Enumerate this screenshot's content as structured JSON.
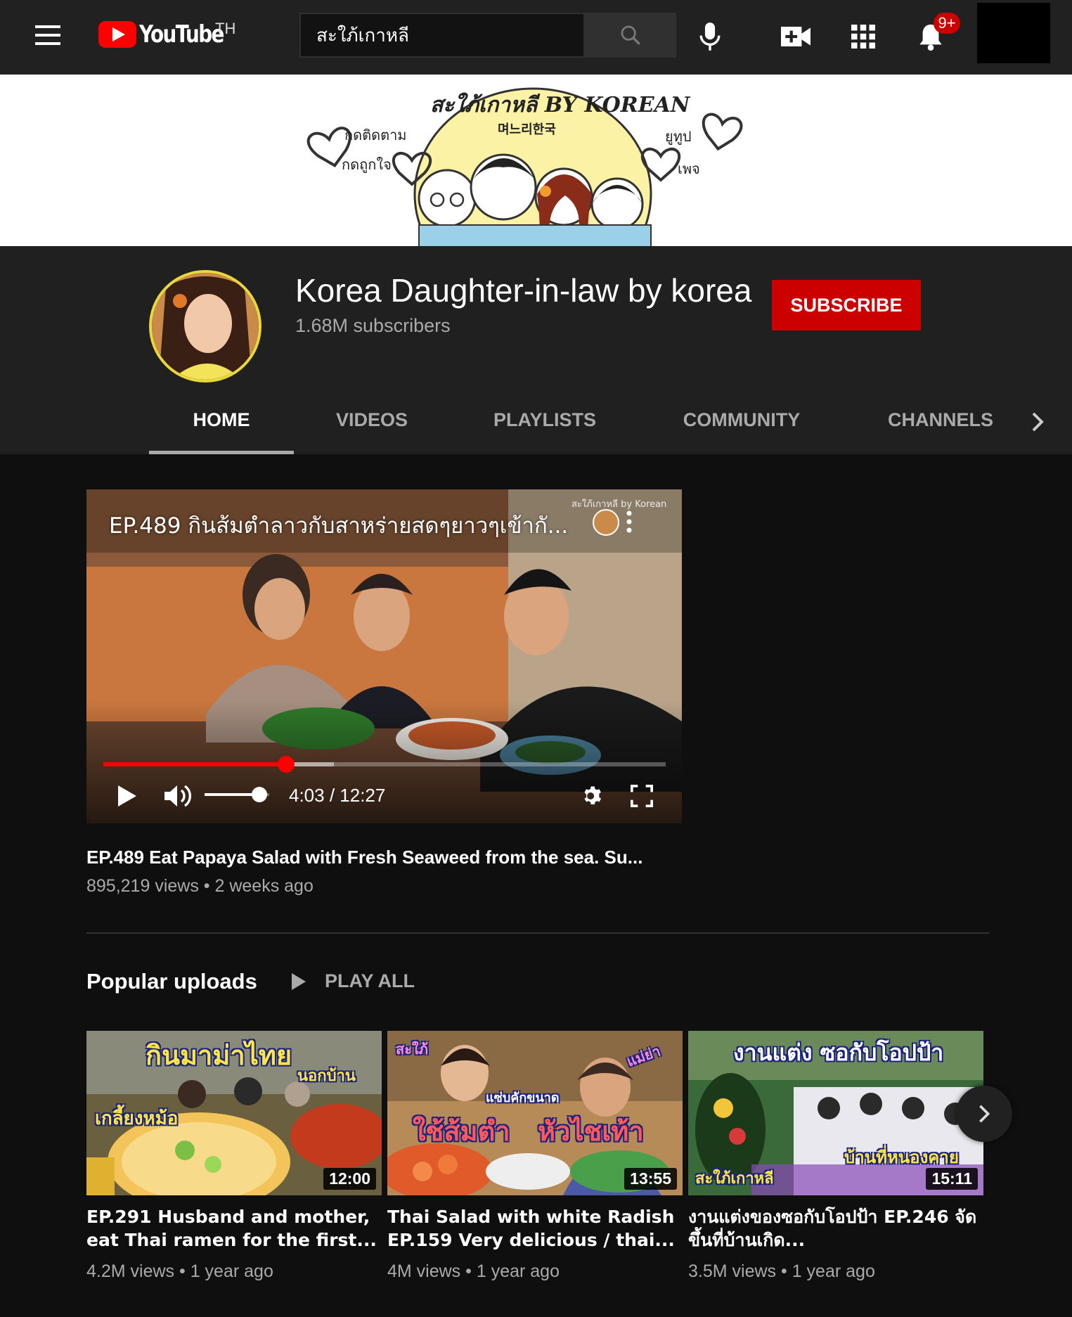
{
  "topbar": {
    "logo_text": "YouTube",
    "region": "TH",
    "search_value": "สะใภ้เกาหลี",
    "notification_count": "9+",
    "icons": [
      "menu-icon",
      "search-icon",
      "mic-icon",
      "create-video-icon",
      "apps-icon",
      "bell-icon"
    ]
  },
  "banner": {
    "title": "สะใภ้เกาหลี BY KOREAN",
    "korean": "며느리한국",
    "left_top": "กดติดตาม",
    "left_bottom": "กดถูกใจ",
    "right_top": "ยูทูป",
    "right_bottom": "เพจ"
  },
  "channel": {
    "name": "Korea Daughter-in-law by korea",
    "subscribers": "1.68M subscribers",
    "subscribe_label": "SUBSCRIBE",
    "tabs": [
      {
        "label": "HOME",
        "active": true
      },
      {
        "label": "VIDEOS",
        "active": false
      },
      {
        "label": "PLAYLISTS",
        "active": false
      },
      {
        "label": "COMMUNITY",
        "active": false
      },
      {
        "label": "CHANNELS",
        "active": false
      }
    ]
  },
  "featured": {
    "overlay_title": "EP.489 กินส้มตำลาวกับสาหร่ายสดๆยาวๆเข้ากั...",
    "watermark": "สะใภ้เกาหลี by Korean",
    "time": "4:03 / 12:27",
    "progress_fraction": 0.325,
    "buffered_fraction": 0.41,
    "volume_fraction": 0.85,
    "title": "EP.489 Eat Papaya Salad with Fresh Seaweed from the sea. Su...",
    "views": "895,219 views",
    "age": "2 weeks ago"
  },
  "popular": {
    "heading": "Popular uploads",
    "play_all": "PLAY ALL",
    "cards": [
      {
        "title": "EP.291 Husband and mother, eat Thai ramen for the first...",
        "views": "4.2M views",
        "age": "1 year ago",
        "duration": "12:00",
        "thumb_text_1": "กินมาม่าไทย",
        "thumb_text_2": "นอกบ้าน",
        "thumb_text_3": "เกลี้ยงหม้อ"
      },
      {
        "title": "Thai Salad with white Radish EP.159 Very delicious / thai...",
        "views": "4M views",
        "age": "1 year ago",
        "duration": "13:55",
        "thumb_text_1": "ใช้ส้มตำ",
        "thumb_text_2": "หัวไชเท้า",
        "thumb_text_3": "แซ่บคักขนาด"
      },
      {
        "title": "งานแต่งของซอกับโอปป้า EP.246 จัดขึ้นที่บ้านเกิด...",
        "views": "3.5M views",
        "age": "1 year ago",
        "duration": "15:11",
        "thumb_text_1": "งานแต่ง ซอกับโอปป้า",
        "thumb_text_2": "บ้านที่หนองคาย",
        "thumb_text_3": "สะใภ้เกาหลี"
      }
    ]
  },
  "colors": {
    "accent_red": "#cc0000",
    "background": "#0f0f0f",
    "header_bg": "#202020"
  }
}
